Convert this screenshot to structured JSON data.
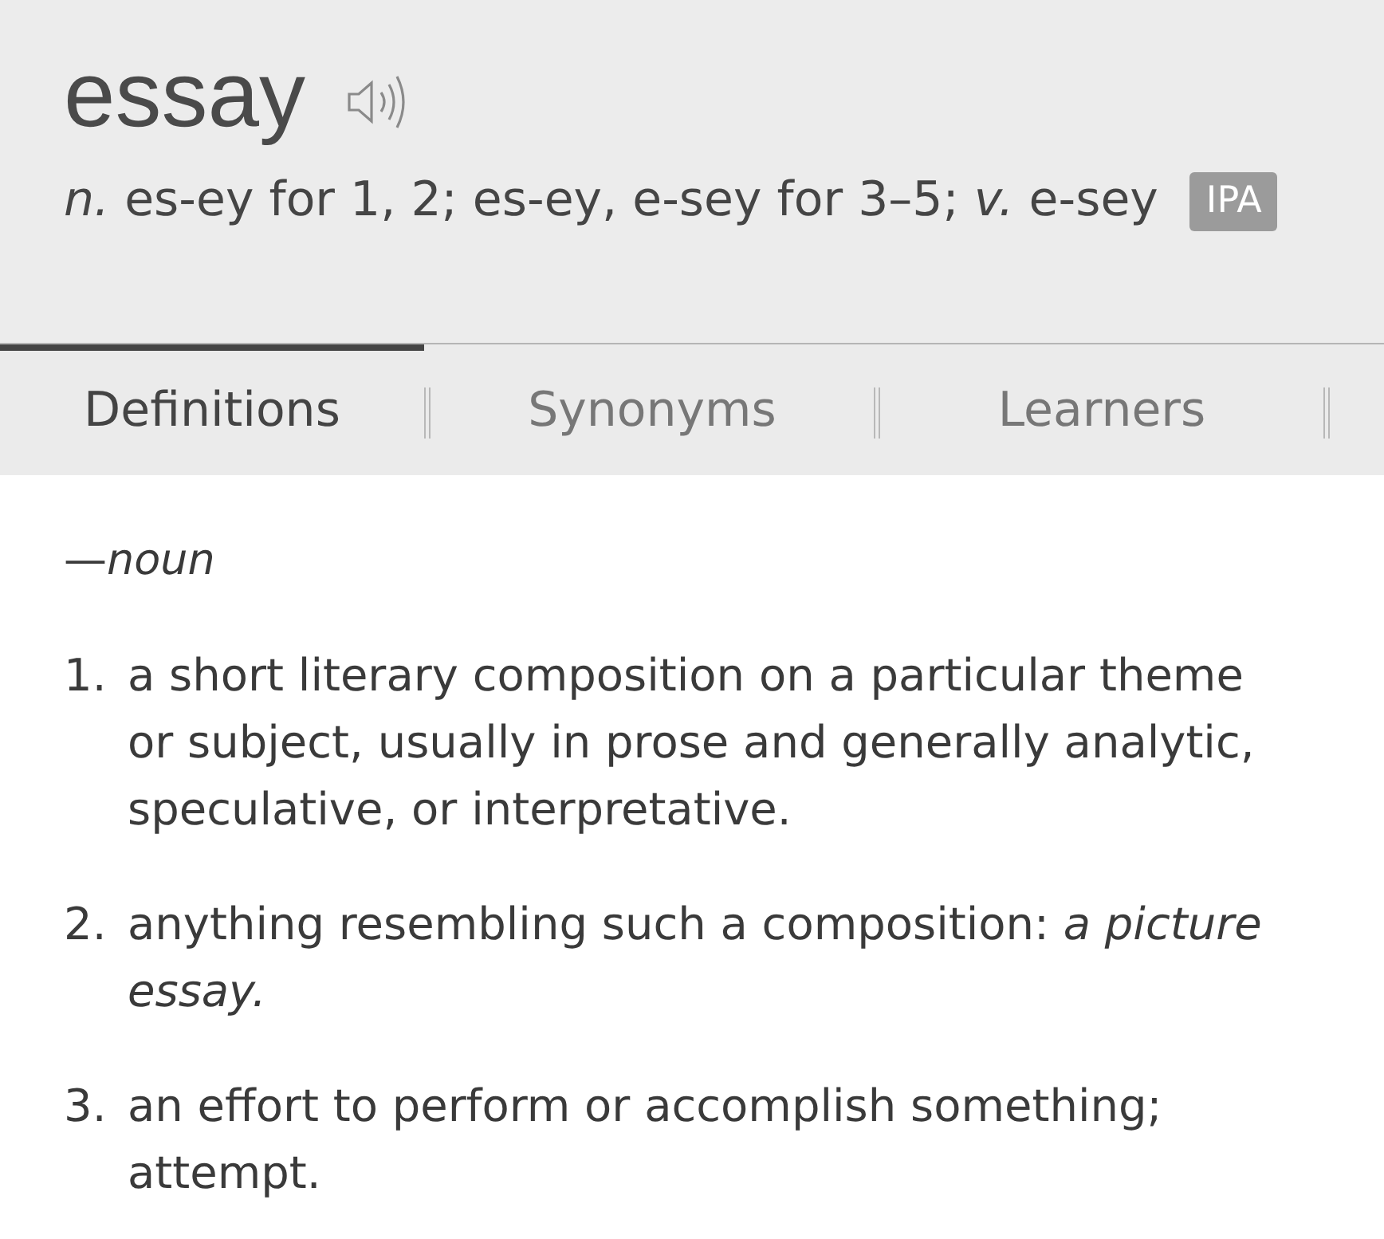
{
  "entry": {
    "headword": "essay",
    "pronunciation": "*n.* es-ey for 1, 2; es-ey, e-sey for 3–5; *v.* e-sey",
    "ipa_button": "IPA"
  },
  "tabs": [
    {
      "label": "Definitions",
      "selected": true
    },
    {
      "label": "Synonyms",
      "selected": false
    },
    {
      "label": "Learners",
      "selected": false
    }
  ],
  "part_of_speech": "—*noun*",
  "definitions": [
    {
      "number": "1.",
      "text": "a short literary composition on a particular theme or subject, usually in prose and generally analytic, speculative, or interpretative."
    },
    {
      "number": "2.",
      "text": "anything resembling such a composition: *a picture essay.*"
    },
    {
      "number": "3.",
      "text": "an effort to perform or accomplish something; attempt."
    }
  ]
}
